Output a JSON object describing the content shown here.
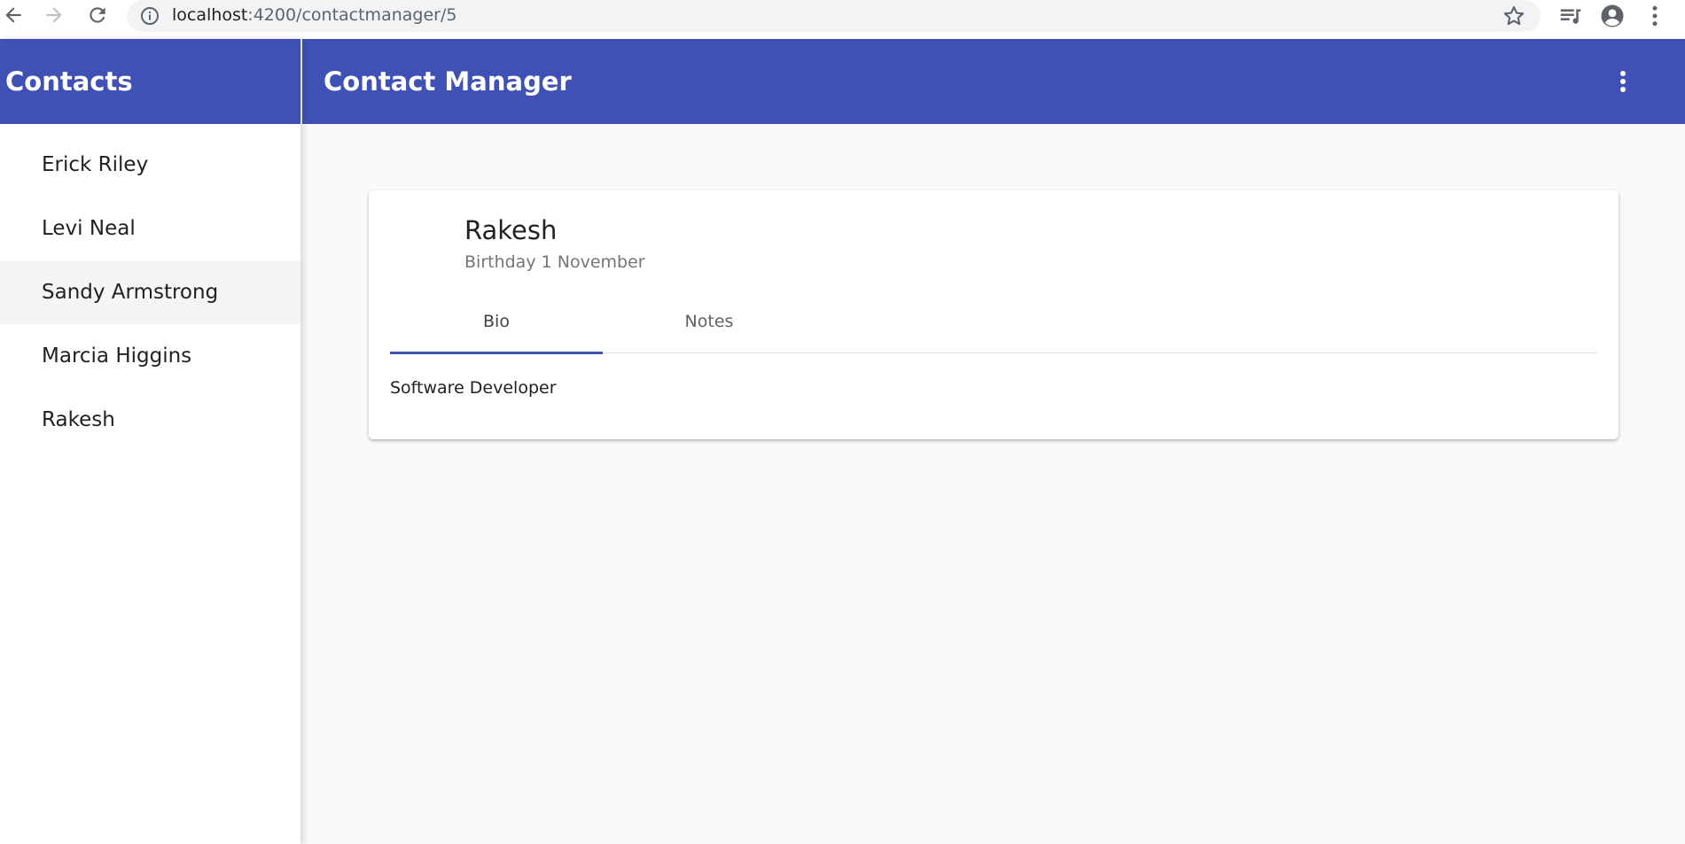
{
  "browser": {
    "url_host": "localhost",
    "url_path": ":4200/contactmanager/5"
  },
  "sidebar": {
    "title": "Contacts",
    "contacts": [
      {
        "name": "Erick Riley"
      },
      {
        "name": "Levi Neal"
      },
      {
        "name": "Sandy Armstrong",
        "active": true
      },
      {
        "name": "Marcia Higgins"
      },
      {
        "name": "Rakesh"
      }
    ]
  },
  "toolbar": {
    "title": "Contact Manager"
  },
  "contact_card": {
    "name": "Rakesh",
    "subtitle": "Birthday 1 November",
    "tabs": [
      {
        "label": "Bio",
        "selected": true
      },
      {
        "label": "Notes",
        "selected": false
      }
    ],
    "bio": "Software Developer"
  },
  "colors": {
    "primary": "#3f51b5",
    "background": "#fafafa"
  }
}
